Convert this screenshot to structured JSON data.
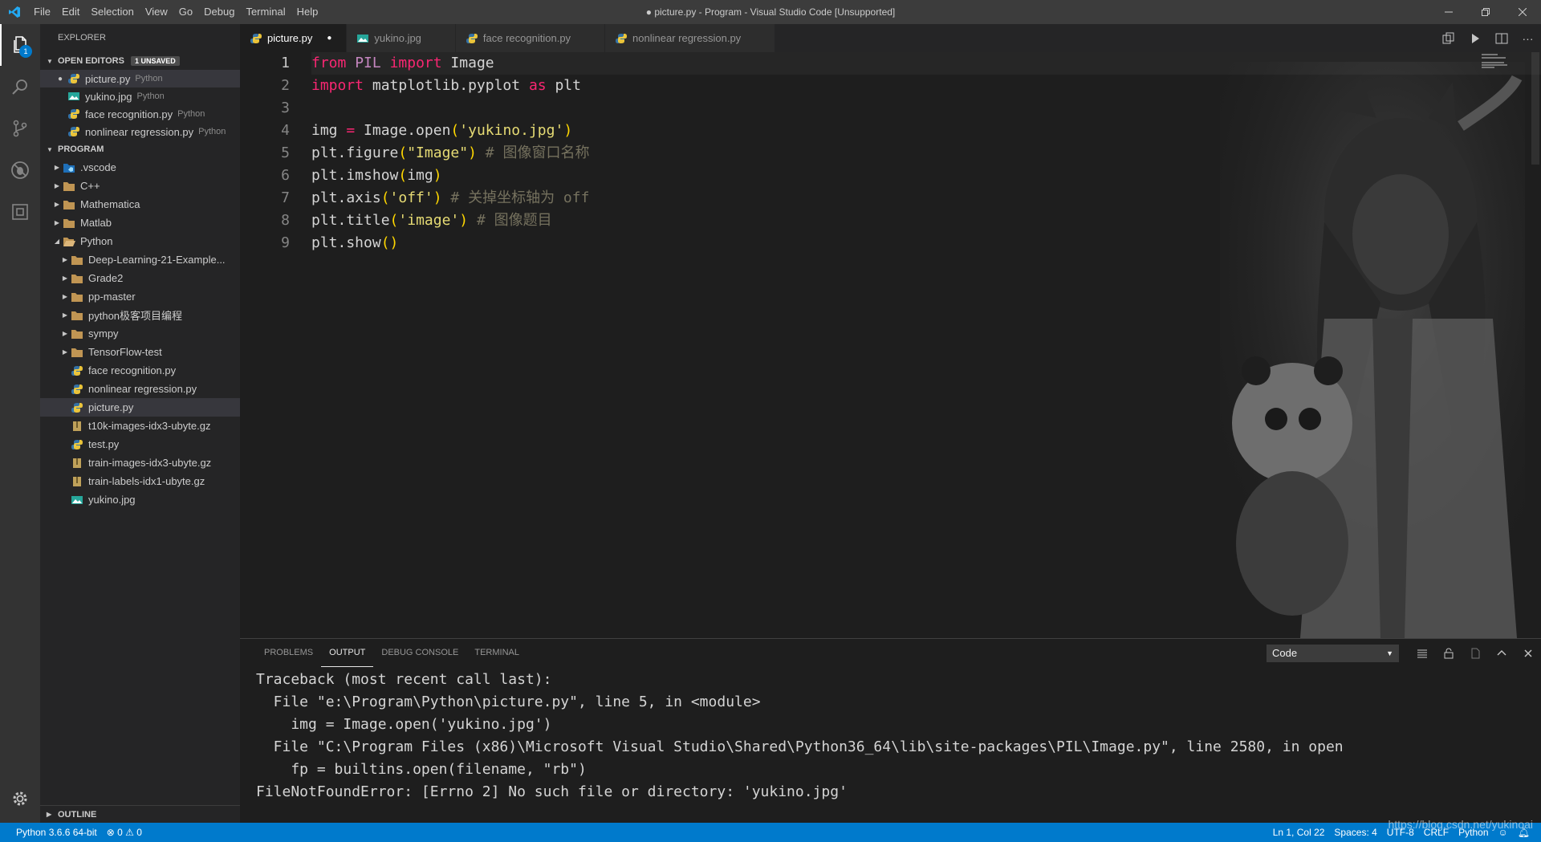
{
  "titlebar": {
    "title": "● picture.py - Program - Visual Studio Code [Unsupported]",
    "menu": [
      "File",
      "Edit",
      "Selection",
      "View",
      "Go",
      "Debug",
      "Terminal",
      "Help"
    ]
  },
  "activity": {
    "badge": "1"
  },
  "sidebar": {
    "title": "EXPLORER",
    "open_editors_label": "OPEN EDITORS",
    "unsaved_badge": "1 UNSAVED",
    "open_editors": [
      {
        "name": "picture.py",
        "desc": "Python",
        "icon": "python-file-icon",
        "dirty": true
      },
      {
        "name": "yukino.jpg",
        "desc": "Python",
        "icon": "image-file-icon",
        "dirty": false
      },
      {
        "name": "face recognition.py",
        "desc": "Python",
        "icon": "python-file-icon",
        "dirty": false
      },
      {
        "name": "nonlinear regression.py",
        "desc": "Python",
        "icon": "python-file-icon",
        "dirty": false
      }
    ],
    "program_label": "PROGRAM",
    "tree": [
      {
        "name": ".vscode",
        "level": 1,
        "type": "folder-vscode",
        "caret": "closed"
      },
      {
        "name": "C++",
        "level": 1,
        "type": "folder",
        "caret": "closed"
      },
      {
        "name": "Mathematica",
        "level": 1,
        "type": "folder",
        "caret": "closed"
      },
      {
        "name": "Matlab",
        "level": 1,
        "type": "folder",
        "caret": "closed"
      },
      {
        "name": "Python",
        "level": 1,
        "type": "folder-open",
        "caret": "open"
      },
      {
        "name": "Deep-Learning-21-Example...",
        "level": 2,
        "type": "folder",
        "caret": "closed"
      },
      {
        "name": "Grade2",
        "level": 2,
        "type": "folder",
        "caret": "closed"
      },
      {
        "name": "pp-master",
        "level": 2,
        "type": "folder",
        "caret": "closed"
      },
      {
        "name": "python极客项目编程",
        "level": 2,
        "type": "folder",
        "caret": "closed"
      },
      {
        "name": "sympy",
        "level": 2,
        "type": "folder",
        "caret": "closed"
      },
      {
        "name": "TensorFlow-test",
        "level": 2,
        "type": "folder",
        "caret": "closed"
      },
      {
        "name": "face recognition.py",
        "level": 2,
        "type": "python",
        "caret": "none"
      },
      {
        "name": "nonlinear regression.py",
        "level": 2,
        "type": "python",
        "caret": "none"
      },
      {
        "name": "picture.py",
        "level": 2,
        "type": "python",
        "caret": "none",
        "selected": true
      },
      {
        "name": "t10k-images-idx3-ubyte.gz",
        "level": 2,
        "type": "archive",
        "caret": "none"
      },
      {
        "name": "test.py",
        "level": 2,
        "type": "python",
        "caret": "none"
      },
      {
        "name": "train-images-idx3-ubyte.gz",
        "level": 2,
        "type": "archive",
        "caret": "none"
      },
      {
        "name": "train-labels-idx1-ubyte.gz",
        "level": 2,
        "type": "archive",
        "caret": "none"
      },
      {
        "name": "yukino.jpg",
        "level": 2,
        "type": "image",
        "caret": "none"
      }
    ],
    "outline_label": "OUTLINE"
  },
  "tabs": [
    {
      "label": "picture.py",
      "icon": "python-file-icon",
      "active": true,
      "dirty": true
    },
    {
      "label": "yukino.jpg",
      "icon": "image-file-icon",
      "active": false,
      "dirty": false
    },
    {
      "label": "face recognition.py",
      "icon": "python-file-icon",
      "active": false,
      "dirty": false
    },
    {
      "label": "nonlinear regression.py",
      "icon": "python-file-icon",
      "active": false,
      "dirty": false
    }
  ],
  "editor": {
    "line_numbers": [
      "1",
      "2",
      "3",
      "4",
      "5",
      "6",
      "7",
      "8",
      "9"
    ],
    "lines": [
      "from PIL import Image",
      "import matplotlib.pyplot as plt",
      "",
      "img = Image.open('yukino.jpg')",
      "plt.figure(\"Image\") # 图像窗口名称",
      "plt.imshow(img)",
      "plt.axis('off') # 关掉坐标轴为 off",
      "plt.title('image') # 图像题目",
      "plt.show()"
    ]
  },
  "panel": {
    "tabs": [
      "PROBLEMS",
      "OUTPUT",
      "DEBUG CONSOLE",
      "TERMINAL"
    ],
    "active_tab": "OUTPUT",
    "output_channel": "Code",
    "output_lines": [
      "Traceback (most recent call last):",
      "  File \"e:\\Program\\Python\\picture.py\", line 5, in <module>",
      "    img = Image.open('yukino.jpg')",
      "  File \"C:\\Program Files (x86)\\Microsoft Visual Studio\\Shared\\Python36_64\\lib\\site-packages\\PIL\\Image.py\", line 2580, in open",
      "    fp = builtins.open(filename, \"rb\")",
      "FileNotFoundError: [Errno 2] No such file or directory: 'yukino.jpg'"
    ]
  },
  "statusbar": {
    "interpreter": "Python 3.6.6 64-bit",
    "errors": "0",
    "warnings": "0",
    "position": "Ln 1, Col 22",
    "spaces": "Spaces: 4",
    "encoding": "UTF-8",
    "eol": "CRLF",
    "language": "Python",
    "watermark": "https://blog.csdn.net/yukinoai"
  },
  "colors": {
    "statusbar": "#007acc",
    "keyword": "#f92672",
    "string": "#e6db74",
    "comment": "#75715e"
  }
}
